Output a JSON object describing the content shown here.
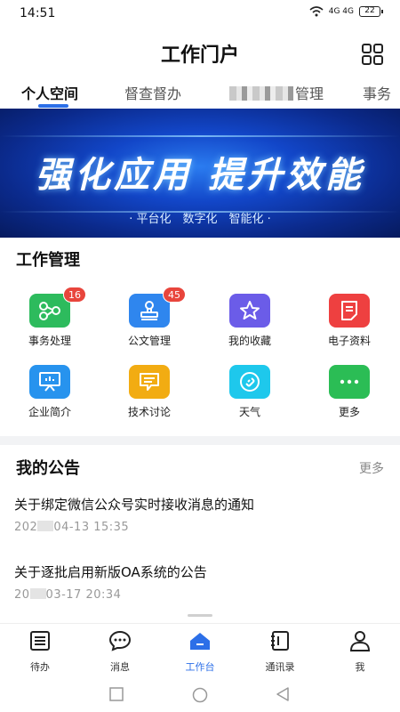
{
  "status": {
    "time": "14:51",
    "signal": "4G 4G",
    "battery": "22"
  },
  "app": {
    "title": "工作门户"
  },
  "tabs": [
    {
      "label": "个人空间",
      "active": true
    },
    {
      "label": "督查督办",
      "active": false
    },
    {
      "label": "管理",
      "active": false
    },
    {
      "label": "事务",
      "active": false
    }
  ],
  "banner": {
    "title": "强化应用 提升效能",
    "subtitle": "· 平台化　数字化　智能化 ·"
  },
  "work": {
    "title": "工作管理",
    "items": [
      {
        "label": "事务处理",
        "icon": "flow-icon",
        "color": "#2dbb5d",
        "badge": "16"
      },
      {
        "label": "公文管理",
        "icon": "stamp-icon",
        "color": "#2f86ee",
        "badge": "45"
      },
      {
        "label": "我的收藏",
        "icon": "star-icon",
        "color": "#6b5ce8",
        "badge": ""
      },
      {
        "label": "电子资料",
        "icon": "document-icon",
        "color": "#ee4040",
        "badge": ""
      },
      {
        "label": "企业简介",
        "icon": "presentation-icon",
        "color": "#2793ee",
        "badge": ""
      },
      {
        "label": "技术讨论",
        "icon": "chat-icon",
        "color": "#f2ac12",
        "badge": ""
      },
      {
        "label": "天气",
        "icon": "link-icon",
        "color": "#1ec8ec",
        "badge": ""
      },
      {
        "label": "更多",
        "icon": "more-icon",
        "color": "#2bbd55",
        "badge": ""
      }
    ]
  },
  "notices": {
    "title": "我的公告",
    "more": "更多",
    "items": [
      {
        "title": "关于绑定微信公众号实时接收消息的通知",
        "time_prefix": "202",
        "time_suffix": "04-13 15:35"
      },
      {
        "title": "关于逐批启用新版OA系统的公告",
        "time_prefix": "20",
        "time_suffix": "03-17 20:34"
      }
    ]
  },
  "nav": [
    {
      "label": "待办",
      "icon": "list-icon",
      "active": false
    },
    {
      "label": "消息",
      "icon": "message-icon",
      "active": false
    },
    {
      "label": "工作台",
      "icon": "home-icon",
      "active": true
    },
    {
      "label": "通讯录",
      "icon": "contacts-icon",
      "active": false
    },
    {
      "label": "我",
      "icon": "person-icon",
      "active": false
    }
  ],
  "colors": {
    "accent": "#2c6fe8",
    "badge": "#e8453c"
  }
}
